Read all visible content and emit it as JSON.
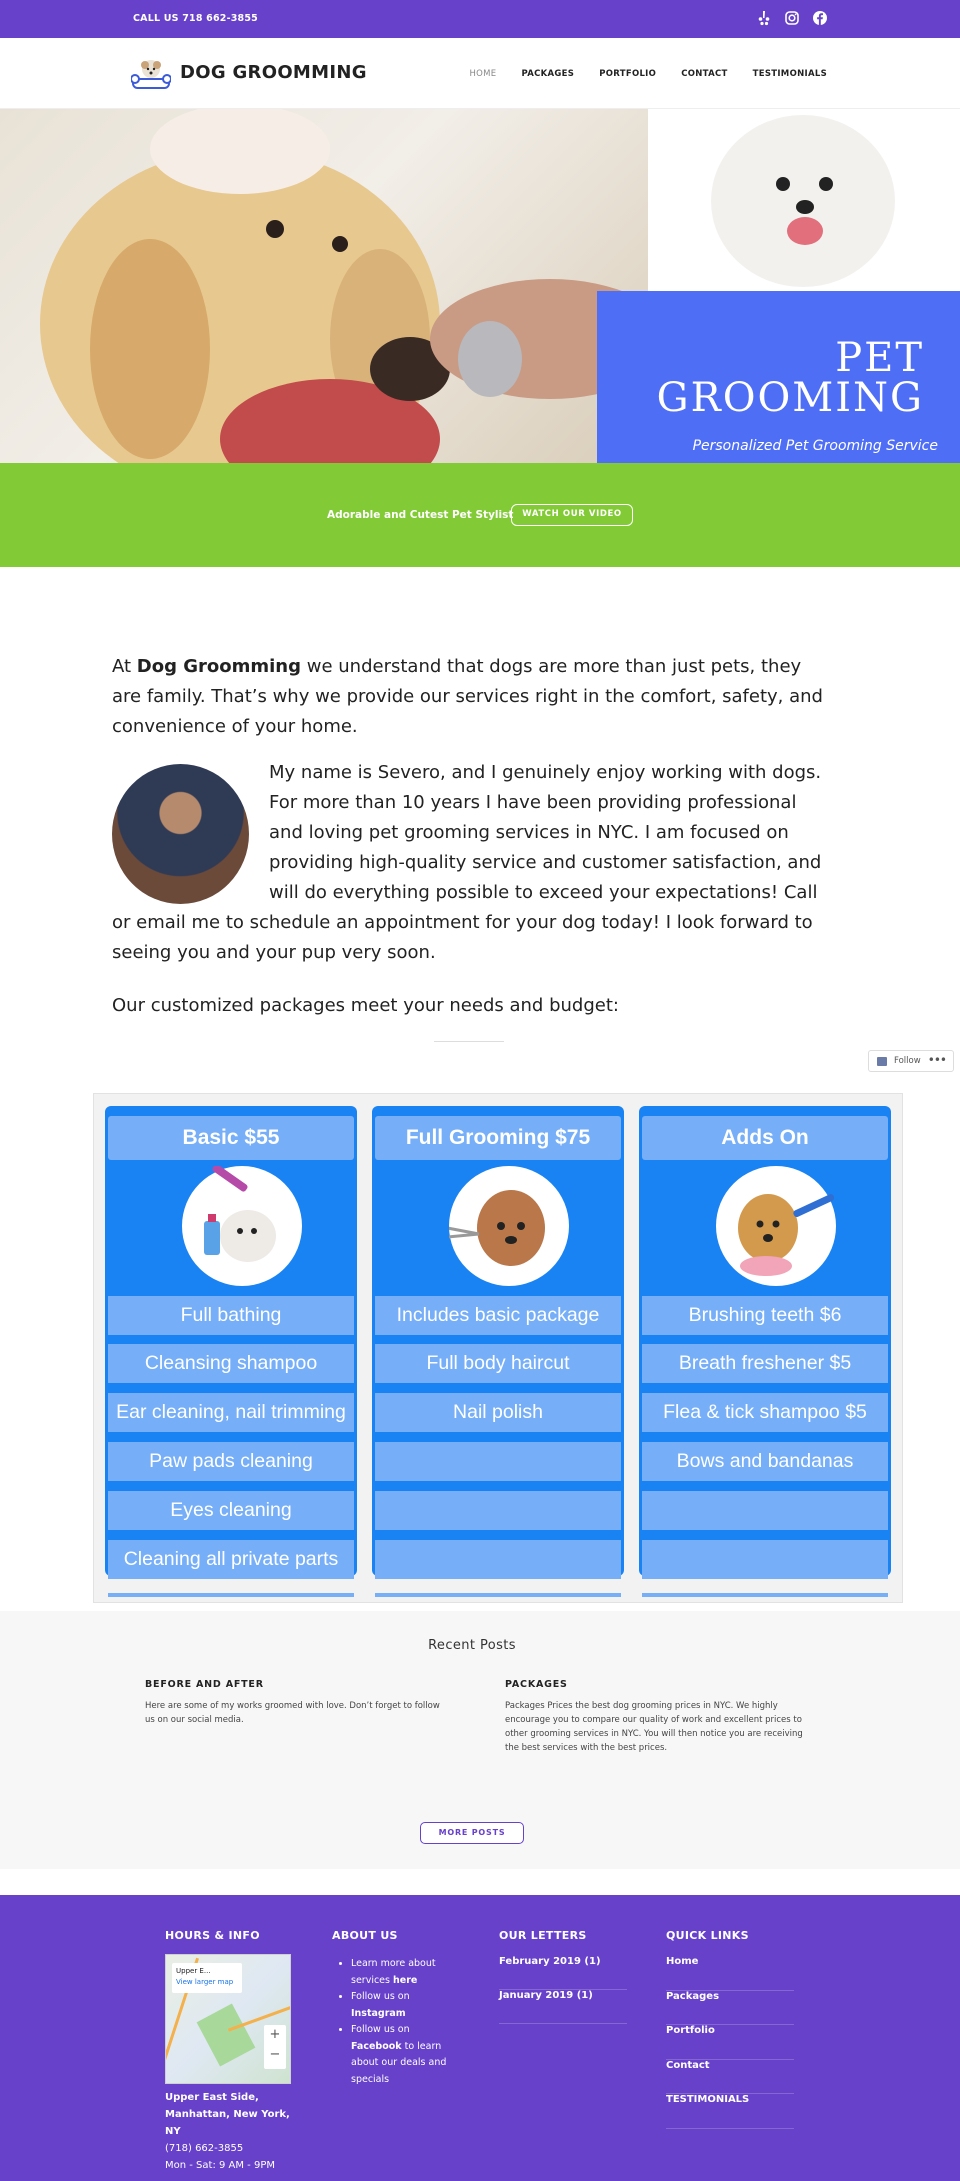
{
  "topbar": {
    "phone": "CALL US 718 662-3855",
    "social": [
      "yelp-icon",
      "instagram-icon",
      "facebook-icon"
    ]
  },
  "header": {
    "title": "DOG GROOMMING",
    "nav": [
      "HOME",
      "PACKAGES",
      "PORTFOLIO",
      "CONTACT",
      "TESTIMONIALS"
    ]
  },
  "hero": {
    "line1": "PET",
    "line2": "GROOMING",
    "subtitle": "Personalized Pet Grooming Service"
  },
  "band": {
    "tagline": "Adorable and Cutest Pet Stylist",
    "button": "WATCH OUR VIDEO"
  },
  "content": {
    "intro_prefix": "At ",
    "intro_bold": "Dog Groomming",
    "intro_rest": " we understand that dogs are more than just pets, they are family. That’s why we provide our services right in the comfort, safety, and convenience of your home.",
    "about": "My name is Severo, and I genuinely enjoy working with dogs. For more than 10 years I have been providing professional and loving pet grooming services in NYC. I am focused on providing high-quality service and customer satisfaction, and will do everything possible to exceed your expectations! Call or email me to schedule an appointment for your dog today! I look forward to seeing you and your pup very soon.",
    "packages_line": "Our customized packages meet your needs and budget:"
  },
  "follow": {
    "label": "Follow",
    "more": "•••"
  },
  "price_table": {
    "columns": [
      {
        "header": "Basic  $55",
        "rows": [
          "Full bathing",
          "Cleansing shampoo",
          "Ear cleaning, nail trimming",
          "Paw pads cleaning",
          "Eyes cleaning",
          "Cleaning all private parts"
        ]
      },
      {
        "header": "Full Grooming $75",
        "rows": [
          "Includes basic package",
          "Full body haircut",
          "Nail polish",
          "",
          "",
          ""
        ]
      },
      {
        "header": "Adds On",
        "rows": [
          "Brushing teeth $6",
          "Breath freshener $5",
          "Flea & tick shampoo $5",
          "Bows and bandanas",
          "",
          ""
        ]
      }
    ]
  },
  "recent_posts": {
    "title": "Recent Posts",
    "posts": [
      {
        "title": "BEFORE AND AFTER",
        "excerpt": "Here are some of my works groomed with love. Don’t forget to follow us on our social media."
      },
      {
        "title": "PACKAGES",
        "excerpt": "Packages Prices the best dog grooming prices in NYC. We highly encourage you to compare our quality of work and excellent prices to other grooming services in NYC. You will then notice you are receiving the best services with the best prices."
      }
    ],
    "button": "MORE POSTS"
  },
  "footer": {
    "hours": {
      "heading": "HOURS & INFO",
      "map_place": "Upper E...",
      "map_link": "View larger map",
      "address": "Upper East Side, Manhattan, New York, NY",
      "phone": "(718) 662-3855",
      "hours": "Mon - Sat: 9 AM - 9PM"
    },
    "about": {
      "heading": "ABOUT US",
      "item1_pre": "Learn more about services ",
      "item1_bold": "here",
      "item2_pre": "Follow us on ",
      "item2_bold": "Instagram",
      "item3_pre": "Follow us on ",
      "item3_bold": "Facebook",
      "item3_post": " to learn about our deals and specials"
    },
    "letters": {
      "heading": "OUR LETTERS",
      "items": [
        "February 2019 (1)",
        "January 2019 (1)"
      ]
    },
    "quick_links": {
      "heading": "QUICK LINKS",
      "items": [
        "Home",
        "Packages",
        "Portfolio",
        "Contact",
        "TESTIMONIALS"
      ]
    }
  }
}
